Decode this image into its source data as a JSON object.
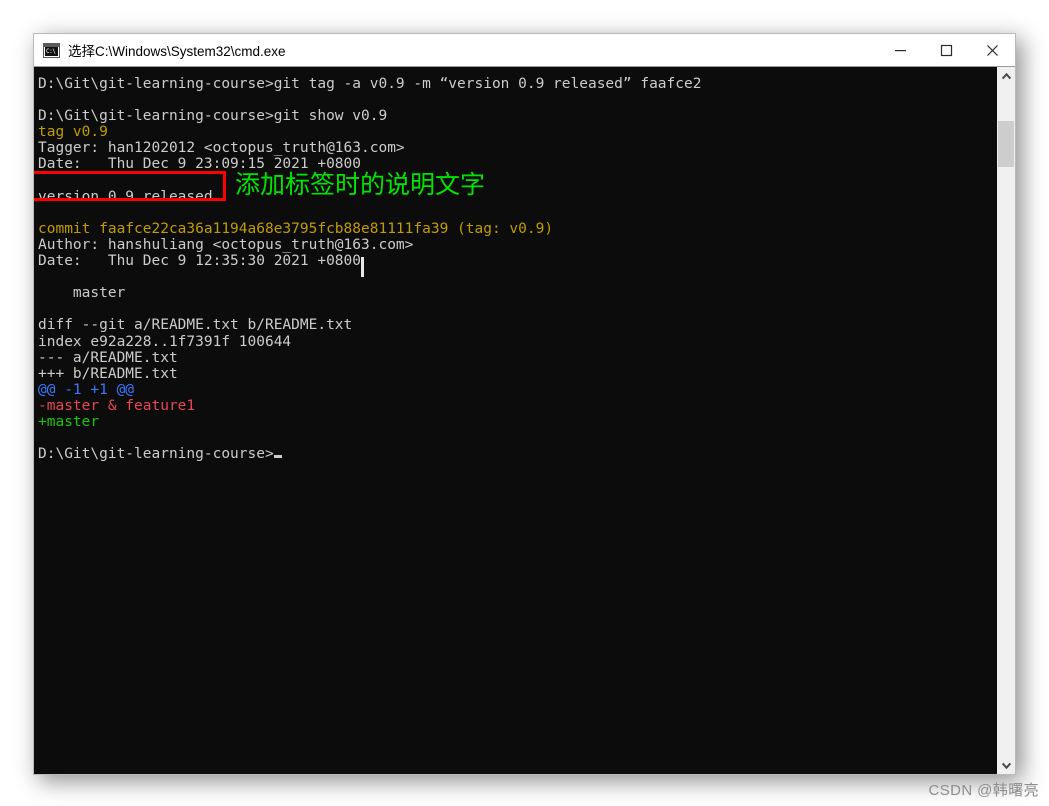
{
  "window": {
    "title": "选择C:\\Windows\\System32\\cmd.exe",
    "icon": "cmd-console-icon",
    "icon_glyph": "C:\\",
    "controls": {
      "minimize_label": "Minimize",
      "maximize_label": "Maximize",
      "close_label": "Close"
    }
  },
  "terminal": {
    "background_color": "#0c0c0c",
    "foreground_color": "#cccccc",
    "lines": [
      {
        "id": "l01",
        "color": "white",
        "text": "D:\\Git\\git-learning-course>git tag -a v0.9 -m “version 0.9 released” faafce2"
      },
      {
        "id": "l02",
        "color": "white",
        "text": ""
      },
      {
        "id": "l03",
        "color": "white",
        "text": "D:\\Git\\git-learning-course>git show v0.9"
      },
      {
        "id": "l04",
        "color": "yellow",
        "text": "tag v0.9"
      },
      {
        "id": "l05",
        "color": "white",
        "text": "Tagger: han1202012 <octopus_truth@163.com>"
      },
      {
        "id": "l06",
        "color": "white",
        "text": "Date:   Thu Dec 9 23:09:15 2021 +0800"
      },
      {
        "id": "l07",
        "color": "white",
        "text": ""
      },
      {
        "id": "l08",
        "color": "white",
        "text": "version 0.9 released"
      },
      {
        "id": "l09",
        "color": "white",
        "text": ""
      },
      {
        "id": "l10",
        "color": "yellow",
        "text": "commit faafce22ca36a1194a68e3795fcb88e81111fa39 (tag: v0.9)"
      },
      {
        "id": "l11",
        "color": "white",
        "text": "Author: hanshuliang <octopus_truth@163.com>"
      },
      {
        "id": "l12",
        "color": "white",
        "text": "Date:   Thu Dec 9 12:35:30 2021 +0800"
      },
      {
        "id": "l13",
        "color": "white",
        "text": ""
      },
      {
        "id": "l14",
        "color": "white",
        "text": "    master"
      },
      {
        "id": "l15",
        "color": "white",
        "text": ""
      },
      {
        "id": "l16",
        "color": "white",
        "text": "diff --git a/README.txt b/README.txt"
      },
      {
        "id": "l17",
        "color": "white",
        "text": "index e92a228..1f7391f 100644"
      },
      {
        "id": "l18",
        "color": "white",
        "text": "--- a/README.txt"
      },
      {
        "id": "l19",
        "color": "white",
        "text": "+++ b/README.txt"
      },
      {
        "id": "l20",
        "color": "blue",
        "text": "@@ -1 +1 @@"
      },
      {
        "id": "l21",
        "color": "red",
        "text": "-master & feature1"
      },
      {
        "id": "l22",
        "color": "green",
        "text": "+master"
      },
      {
        "id": "l23",
        "color": "white",
        "text": ""
      },
      {
        "id": "l24",
        "color": "white",
        "text": "D:\\Git\\git-learning-course>",
        "cursor": true
      }
    ]
  },
  "annotations": {
    "highlight_box": {
      "label": "version 0.9 released",
      "color": "#fe0000"
    },
    "note": {
      "text": "添加标签时的说明文字",
      "color": "#00e500"
    }
  },
  "scrollbar": {
    "up_arrow": "chevron-up-icon",
    "down_arrow": "chevron-down-icon"
  },
  "watermark": {
    "text": "CSDN @韩曙亮"
  }
}
